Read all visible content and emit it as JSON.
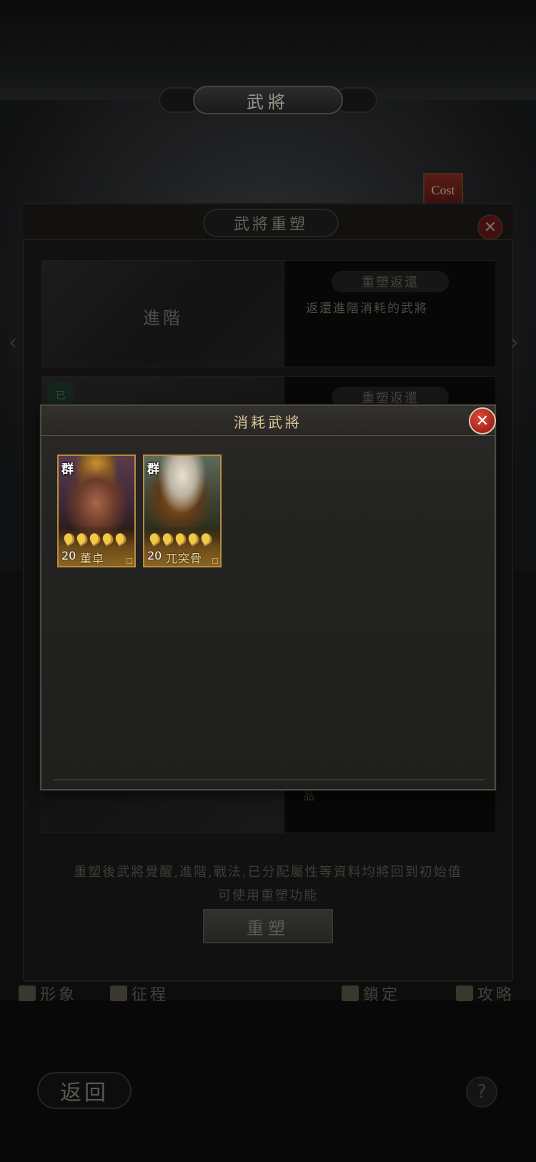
{
  "screen": {
    "title": "武將"
  },
  "cost_tag": "Cost",
  "remold_panel": {
    "title": "武將重塑",
    "close_symbol": "✕",
    "options": [
      {
        "left_label": "進階",
        "button_label": "重塑返還",
        "description": "返還進階消耗的武將"
      },
      {
        "chip_label": "已",
        "button_label": "重塑返還",
        "peek_text": "品"
      }
    ],
    "notice_line1": "重塑後武將覺醒,進階,戰法,已分配屬性等資料均將回到初始值",
    "notice_line2": "可使用重塑功能",
    "remold_button": "重塑"
  },
  "modal": {
    "title": "消耗武將",
    "close_symbol": "✕",
    "cards": [
      {
        "faction": "群",
        "level": "20",
        "name": "董卓",
        "stars": 5
      },
      {
        "faction": "群",
        "level": "20",
        "name": "兀突骨",
        "stars": 5
      }
    ]
  },
  "bottom_nav": {
    "items": [
      {
        "label": "形象",
        "icon": "figure-icon"
      },
      {
        "label": "征程",
        "icon": "flag-icon"
      },
      {
        "label": "鎖定",
        "icon": "lock-icon"
      },
      {
        "label": "攻略",
        "icon": "guide-flag-icon"
      }
    ],
    "back_label": "返回",
    "help_symbol": "?"
  },
  "colors": {
    "accent_gold": "#d6c59a",
    "close_red": "#c0362a",
    "card_border": "#b88b3e"
  }
}
